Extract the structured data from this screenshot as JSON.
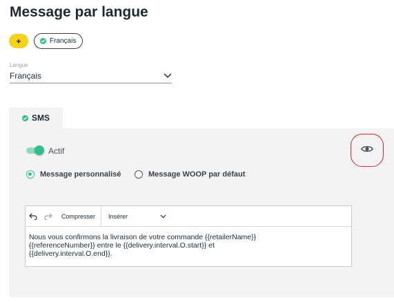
{
  "page": {
    "title": "Message par langue"
  },
  "languages": {
    "add_label": "+",
    "chips": [
      {
        "label": "Français"
      }
    ]
  },
  "language_select": {
    "label": "Langue",
    "value": "Français"
  },
  "tabs": [
    {
      "label": "SMS"
    }
  ],
  "sms_panel": {
    "toggle": {
      "label": "Actif",
      "on": true
    },
    "message_options": [
      {
        "label": "Message personnalisé",
        "selected": true
      },
      {
        "label": "Message WOOP par défaut",
        "selected": false
      }
    ],
    "editor": {
      "toolbar": {
        "compress_label": "Compresser",
        "insert_label": "Insérer"
      },
      "content_line1": "Nous vous confirmons la livraison de votre commande {{retailerName}}",
      "content_line2": "{{referenceNumber}} entre le {{delivery.interval.O.start}} et",
      "content_line3": "{{delivery.interval.O.end}}."
    },
    "preview_icon": "eye-icon"
  },
  "colors": {
    "accent_green": "#2fbf8b",
    "add_yellow": "#f6d21b",
    "highlight_red": "#e0222b"
  }
}
